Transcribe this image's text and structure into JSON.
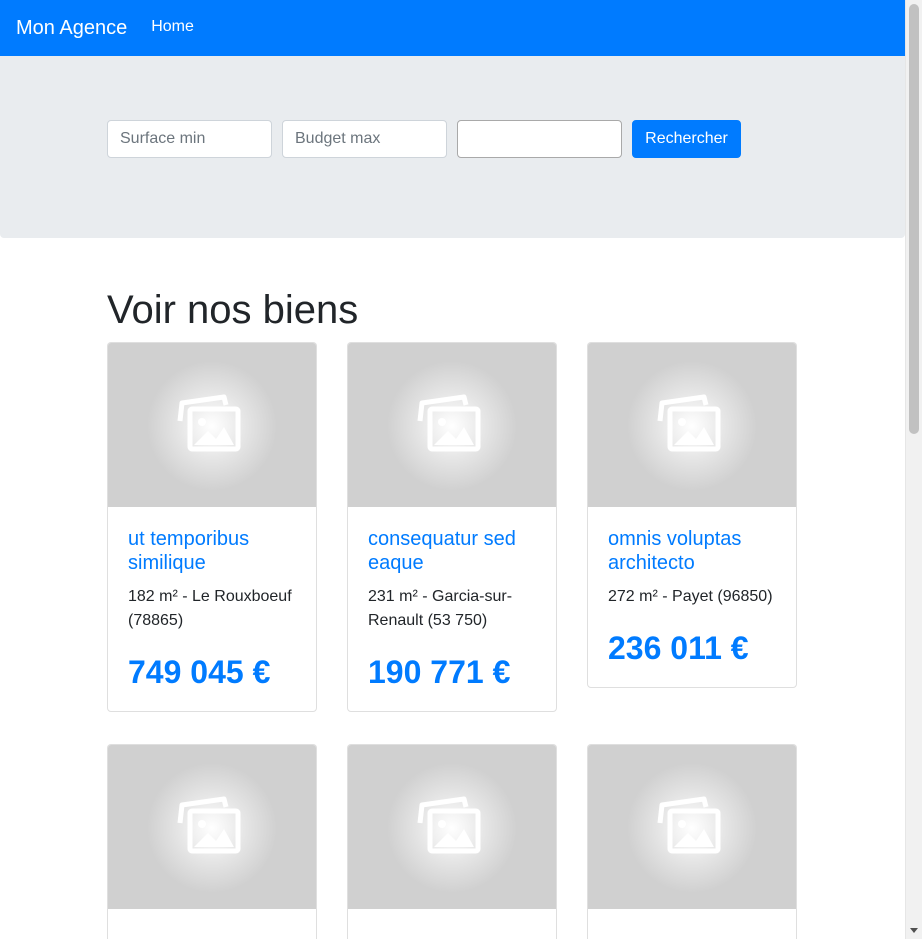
{
  "navbar": {
    "brand": "Mon Agence",
    "home_link": "Home",
    "color": "#007bff"
  },
  "search": {
    "surface_placeholder": "Surface min",
    "budget_placeholder": "Budget max",
    "third_value": "",
    "button_label": "Rechercher"
  },
  "section": {
    "title": "Voir nos biens"
  },
  "properties": [
    {
      "title": "ut temporibus similique",
      "details": "182 m² - Le Rouxboeuf (78865)",
      "price": "749 045 €",
      "image_icon": "image-placeholder-icon"
    },
    {
      "title": "consequatur sed eaque",
      "details": "231 m² - Garcia-sur-Renault (53 750)",
      "price": "190 771 €",
      "image_icon": "image-placeholder-icon"
    },
    {
      "title": "omnis voluptas architecto",
      "details": "272 m² - Payet (96850)",
      "price": "236 011 €",
      "image_icon": "image-placeholder-icon"
    }
  ]
}
